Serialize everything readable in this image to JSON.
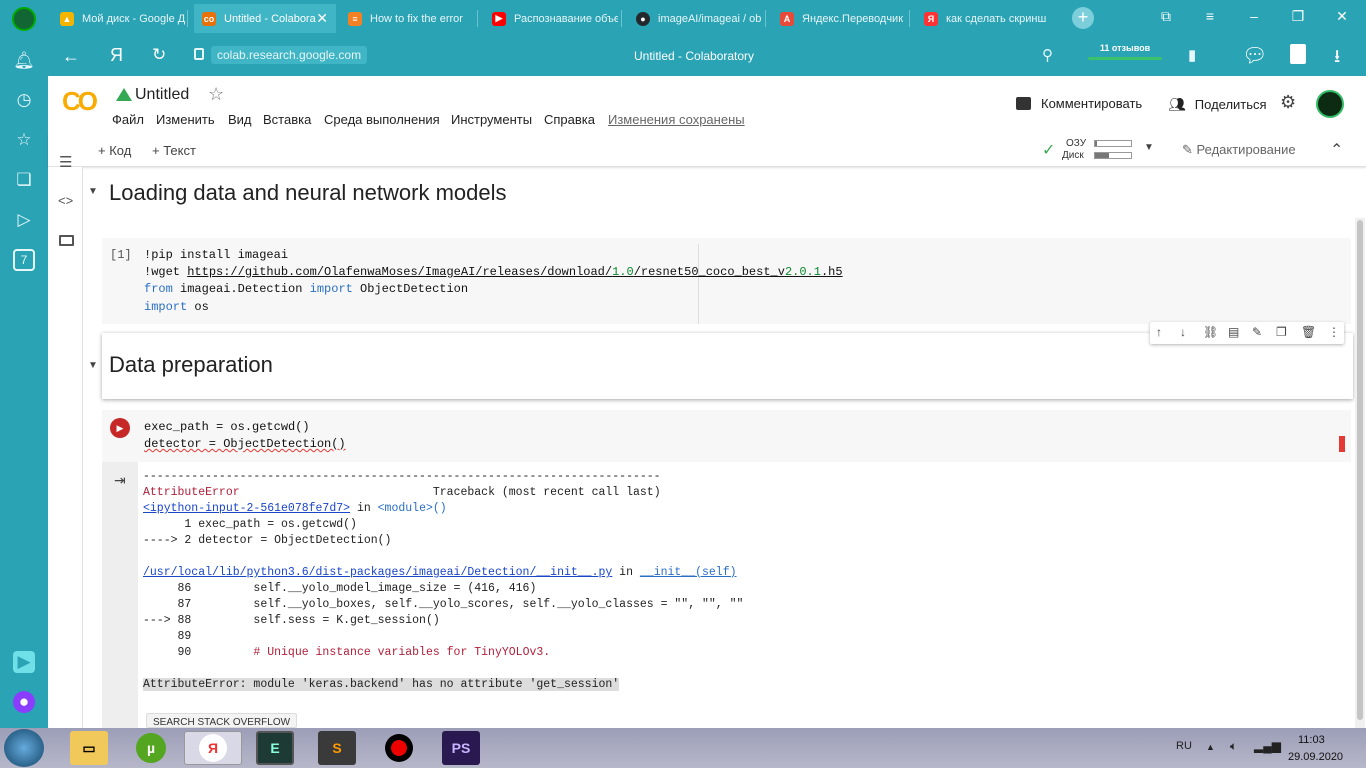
{
  "browser": {
    "tabs": [
      {
        "label": "Мой диск - Google Ди",
        "icon": "google-drive-icon",
        "color": "#f4b400"
      },
      {
        "label": "Untitled - Colabora",
        "icon": "colab-icon",
        "color": "#e8710a"
      },
      {
        "label": "How to fix the error",
        "icon": "stackoverflow-icon",
        "color": "#f48024"
      },
      {
        "label": "Распознавание объе",
        "icon": "youtube-icon",
        "color": "#ff0000"
      },
      {
        "label": "imageAI/imageai / ob",
        "icon": "github-icon",
        "color": "#24292e"
      },
      {
        "label": "Яндекс.Переводчик",
        "icon": "translate-icon",
        "color": "#e84a3a"
      },
      {
        "label": "как сделать скринш",
        "icon": "yandex-icon",
        "color": "#ff3333"
      }
    ],
    "url": "colab.research.google.com",
    "page_title": "Untitled - Colaboratory",
    "reviews": "11 отзывов",
    "yandex_letter": "Я"
  },
  "colab": {
    "logo": "CO",
    "title": "Untitled",
    "menu": [
      "Файл",
      "Изменить",
      "Вид",
      "Вставка",
      "Среда выполнения",
      "Инструменты",
      "Справка"
    ],
    "saved_status": "Изменения сохранены",
    "comment_btn": "Комментировать",
    "share_btn": "Поделиться",
    "add_code": "Код",
    "add_text": "Текст",
    "ram_label": "ОЗУ",
    "disk_label": "Диск",
    "ram_fraction": 0.05,
    "disk_fraction": 0.4,
    "editing": "Редактирование",
    "side_badge": "7"
  },
  "cells": {
    "heading1": "Loading data and neural network models",
    "cell1_prompt": "[1]",
    "cell1_lines": {
      "l1": "!pip install imageai",
      "l2_pre": "!wget ",
      "l2_url_a": "https://github.com/OlafenwaMoses/ImageAI/releases/download/",
      "l2_url_b": "1.0",
      "l2_url_c": "/resnet50_coco_best_v",
      "l2_url_d": "2.0.1",
      "l2_url_e": ".h5",
      "l3_from": "from",
      "l3_mod": " imageai.Detection ",
      "l3_import": "import",
      "l3_name": " ObjectDetection",
      "l4_import": "import",
      "l4_name": " os"
    },
    "heading2": "Data preparation",
    "cell2_lines": {
      "l1": "exec_path = os.getcwd()",
      "l2": "detector = ObjectDetection()"
    },
    "output": {
      "dashes": "---------------------------------------------------------------------------",
      "err_name": "AttributeError",
      "traceback": "Traceback (most recent call last)",
      "input_link": "<ipython-input-2-561e078fe7d7>",
      "in_module_a": " in ",
      "in_module_b": "<module>()",
      "line1": "      1 exec_path = os.getcwd()",
      "line2": "----> 2 detector = ObjectDetection()",
      "file_link": "/usr/local/lib/python3.6/dist-packages/imageai/Detection/__init__.py",
      "in_init_a": " in ",
      "in_init_b": "__init__(self)",
      "l86": "     86         self.__yolo_model_image_size = (416, 416)",
      "l87": "     87         self.__yolo_boxes, self.__yolo_scores, self.__yolo_classes = \"\", \"\", \"\"",
      "l88": "---> 88         self.sess = K.get_session()",
      "l89": "     89",
      "l90_num": "     90         ",
      "l90_comment": "# Unique instance variables for TinyYOLOv3.",
      "final_error": "AttributeError: module 'keras.backend' has no attribute 'get_session'",
      "so_button": "SEARCH STACK OVERFLOW"
    }
  },
  "taskbar": {
    "lang": "RU",
    "time": "11:03",
    "date": "29.09.2020"
  }
}
